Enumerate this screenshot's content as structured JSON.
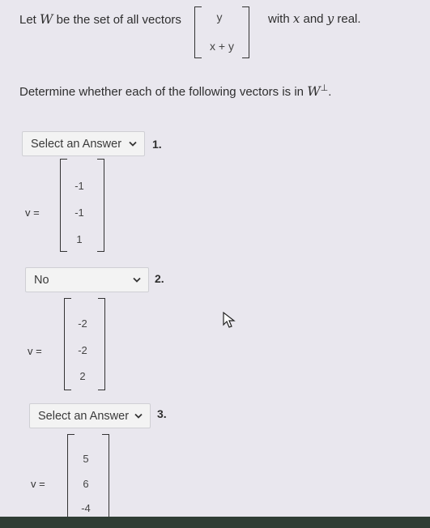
{
  "intro": {
    "prefix": "Let",
    "set_symbol": "W",
    "middle": "be the set of all vectors",
    "vector_top": "y",
    "vector_bottom": "x + y",
    "suffix_with": "with",
    "var_x": "x",
    "and": "and",
    "var_y": "y",
    "real": "real."
  },
  "instruction": {
    "text": "Determine whether each of the following vectors is in",
    "symbol": "W",
    "perp": "⊥",
    "period": "."
  },
  "questions": [
    {
      "number": "1.",
      "answer": "Select an Answer",
      "vector_label": "v =",
      "components": [
        "-1",
        "-1",
        "1"
      ]
    },
    {
      "number": "2.",
      "answer": "No",
      "vector_label": "v =",
      "components": [
        "-2",
        "-2",
        "2"
      ]
    },
    {
      "number": "3.",
      "answer": "Select an Answer",
      "vector_label": "v =",
      "components": [
        "5",
        "6",
        "-4"
      ]
    }
  ]
}
